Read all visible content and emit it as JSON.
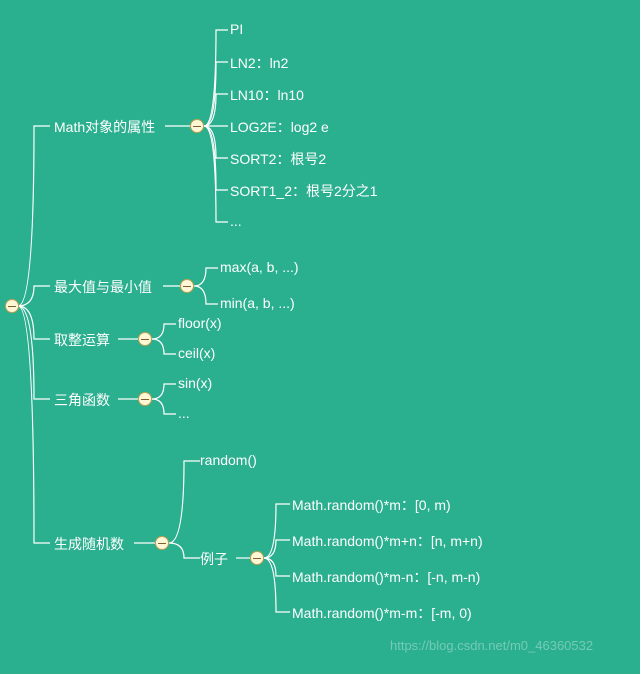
{
  "root": {
    "id": "root"
  },
  "branches": {
    "math_props": {
      "label": "Math对象的属性",
      "children": {
        "pi": "PI",
        "ln2": "LN2：ln2",
        "ln10": "LN10：ln10",
        "log2e": "LOG2E：log2 e",
        "sort2": "SORT2：根号2",
        "sort1_2": "SORT1_2：根号2分之1",
        "more": "..."
      }
    },
    "max_min": {
      "label": "最大值与最小值",
      "children": {
        "max": "max(a, b, ...)",
        "min": "min(a, b, ...)"
      }
    },
    "rounding": {
      "label": "取整运算",
      "children": {
        "floor": "floor(x)",
        "ceil": "ceil(x)"
      }
    },
    "trig": {
      "label": "三角函数",
      "children": {
        "sin": "sin(x)",
        "more": "..."
      }
    },
    "random": {
      "label": "生成随机数",
      "children": {
        "random_fn": "random()",
        "examples": {
          "label": "例子",
          "children": {
            "ex1": "Math.random()*m：[0, m)",
            "ex2": "Math.random()*m+n：[n, m+n)",
            "ex3": "Math.random()*m-n：[-n, m-n)",
            "ex4": "Math.random()*m-m：[-m, 0)"
          }
        }
      }
    }
  },
  "watermark": "https://blog.csdn.net/m0_46360532"
}
